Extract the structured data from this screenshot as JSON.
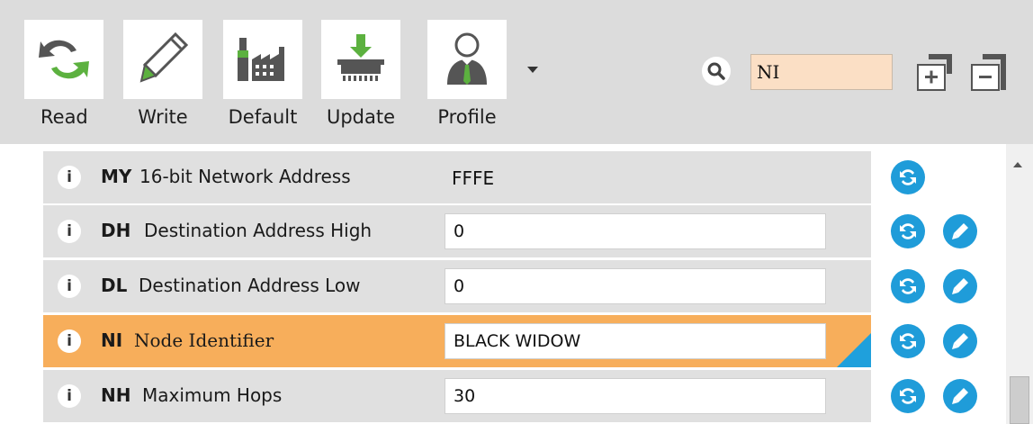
{
  "toolbar": {
    "buttons": [
      {
        "label": "Read",
        "icon": "read-icon"
      },
      {
        "label": "Write",
        "icon": "write-icon"
      },
      {
        "label": "Default",
        "icon": "default-icon"
      },
      {
        "label": "Update",
        "icon": "update-icon"
      },
      {
        "label": "Profile",
        "icon": "profile-icon"
      }
    ],
    "search": {
      "value": "NI"
    }
  },
  "parameters": [
    {
      "command": "MY",
      "description": "16-bit Network Address",
      "value": "FFFE",
      "editable": false
    },
    {
      "command": "DH",
      "description": "Destination Address High",
      "value": "0",
      "editable": true
    },
    {
      "command": "DL",
      "description": "Destination Address Low",
      "value": "0",
      "editable": true
    },
    {
      "command": "NI",
      "description": "Node Identifier",
      "value": "BLACK WIDOW",
      "editable": true,
      "selected": true
    },
    {
      "command": "NH",
      "description": "Maximum Hops",
      "value": "30",
      "editable": true
    }
  ],
  "colors": {
    "toolbar_bg": "#dcdcdc",
    "row_bg": "#e0e0e0",
    "selected_row": "#f7ae5b",
    "search_bg": "#fbdfc5",
    "action_blue": "#1f9cd9",
    "read_green": "#5cb13f"
  }
}
